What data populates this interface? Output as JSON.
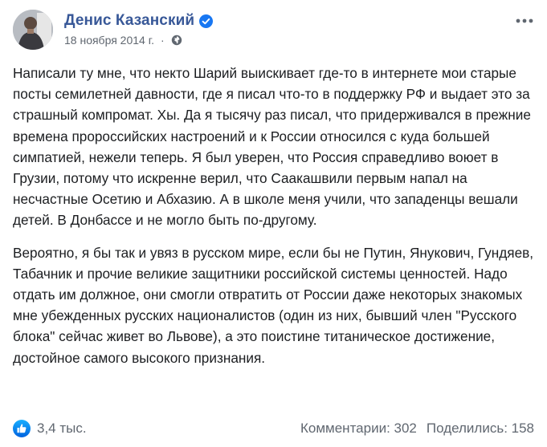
{
  "post": {
    "author": "Денис Казанский",
    "verified": true,
    "date": "18 ноября 2014 г.",
    "separator": "·",
    "privacy_icon": "globe-icon",
    "paragraphs": [
      "Написали ту мне, что некто Шарий выискивает где-то в интернете мои старые посты семилетней давности, где я писал что-то в поддержку РФ и выдает это за страшный компромат. Хы. Да я тысячу раз писал, что придерживался в прежние времена пророссийских настроений и к России относился с куда большей симпатией, нежели теперь. Я был уверен, что Россия справедливо воюет в Грузии, потому что искренне верил, что Саакашвили первым напал на несчастные Осетию и Абхазию. А в школе меня учили, что западенцы вешали детей. В Донбассе и не могло быть по-другому.",
      "Вероятно, я бы так и увяз в русском мире, если бы не Путин, Янукович, Гундяев, Табачник и прочие великие защитники российской системы ценностей. Надо отдать им должное, они смогли отвратить от России даже некоторых знакомых мне убежденных русских националистов (один из них, бывший член \"Русского блока\" сейчас живет во Львове), а это поистине титаническое достижение, достойное самого высокого признания."
    ]
  },
  "footer": {
    "reactions_count": "3,4 тыс.",
    "comments": "Комментарии: 302",
    "shares": "Поделились: 158"
  },
  "colors": {
    "author_link": "#385898",
    "meta_gray": "#606770",
    "text": "#1c1e21",
    "like_blue": "#1877f2"
  }
}
